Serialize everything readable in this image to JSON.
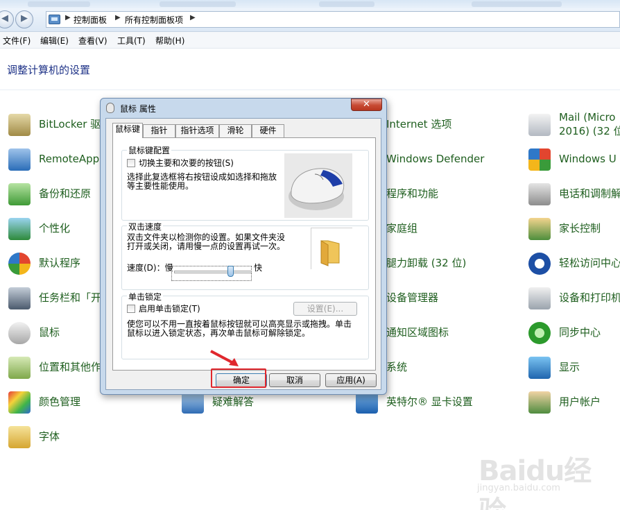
{
  "window": {
    "breadcrumbs": [
      "控制面板",
      "所有控制面板项"
    ],
    "menu": [
      "文件(F)",
      "编辑(E)",
      "查看(V)",
      "工具(T)",
      "帮助(H)"
    ]
  },
  "control_panel": {
    "title": "调整计算机的设置",
    "items": [
      {
        "label": "BitLocker 驱",
        "icon": "bitlocker-icon"
      },
      {
        "label": "RemoteApp",
        "icon": "remoteapp-icon"
      },
      {
        "label": "备份和还原",
        "icon": "backup-icon"
      },
      {
        "label": "个性化",
        "icon": "personalize-icon"
      },
      {
        "label": "默认程序",
        "icon": "default-programs-icon"
      },
      {
        "label": "任务栏和「开",
        "icon": "taskbar-icon"
      },
      {
        "label": "鼠标",
        "icon": "mouse-icon"
      },
      {
        "label": "位置和其他作",
        "icon": "location-icon"
      },
      {
        "label": "颜色管理",
        "icon": "color-icon"
      },
      {
        "label": "字体",
        "icon": "font-icon"
      },
      {
        "label": "疑难解答",
        "icon": "troubleshoot-icon"
      },
      {
        "label": "Internet 选项",
        "icon": "internet-icon"
      },
      {
        "label": "Windows Defender",
        "icon": "defender-icon"
      },
      {
        "label": "程序和功能",
        "icon": "programs-icon"
      },
      {
        "label": "家庭组",
        "icon": "homegroup-icon"
      },
      {
        "label": "腿力卸载 (32 位)",
        "icon": "uninstall-icon"
      },
      {
        "label": "设备管理器",
        "icon": "device-manager-icon"
      },
      {
        "label": "通知区域图标",
        "icon": "notification-icon"
      },
      {
        "label": "系统",
        "icon": "system-icon"
      },
      {
        "label": "英特尔® 显卡设置",
        "icon": "intel-icon"
      },
      {
        "label": "Mail (Micro",
        "label2": "2016) (32 位",
        "icon": "mail-icon"
      },
      {
        "label": "Windows U",
        "icon": "windows-update-icon"
      },
      {
        "label": "电话和调制解",
        "icon": "phone-icon"
      },
      {
        "label": "家长控制",
        "icon": "parental-icon"
      },
      {
        "label": "轻松访问中心",
        "icon": "ease-icon"
      },
      {
        "label": "设备和打印机",
        "icon": "printer-icon"
      },
      {
        "label": "同步中心",
        "icon": "sync-icon"
      },
      {
        "label": "显示",
        "icon": "display-icon"
      },
      {
        "label": "用户帐户",
        "icon": "users-icon"
      }
    ]
  },
  "dialog": {
    "title": "鼠标 属性",
    "close_glyph": "✕",
    "tabs": [
      "鼠标键",
      "指针",
      "指针选项",
      "滑轮",
      "硬件"
    ],
    "button_config": {
      "group": "鼠标键配置",
      "checkbox": "切换主要和次要的按钮(S)",
      "desc1": "选择此复选框将右按钮设成如选择和拖放",
      "desc2": "等主要性能使用。",
      "checked": false
    },
    "double_click": {
      "group": "双击速度",
      "desc1": "双击文件夹以检测你的设置。如果文件夹没",
      "desc2": "打开或关闭，请用慢一点的设置再试一次。",
      "speed_label": "速度(D)：慢",
      "fast_label": "快",
      "speed_fraction": 0.75
    },
    "click_lock": {
      "group": "单击锁定",
      "checkbox": "启用单击锁定(T)",
      "settings_button": "设置(E)...",
      "desc1": "使您可以不用一直按着鼠标按钮就可以高亮显示或拖拽。单击",
      "desc2": "鼠标以进入锁定状态，再次单击鼠标可解除锁定。",
      "checked": false
    },
    "buttons": {
      "ok": "确定",
      "cancel": "取消",
      "apply": "应用(A)"
    }
  },
  "watermark": {
    "text": "Baidu经验",
    "sub": "jingyan.baidu.com"
  },
  "colors": {
    "link_green": "#1e5e1e",
    "title_blue": "#1e3287",
    "highlight_red": "#e0272d"
  }
}
